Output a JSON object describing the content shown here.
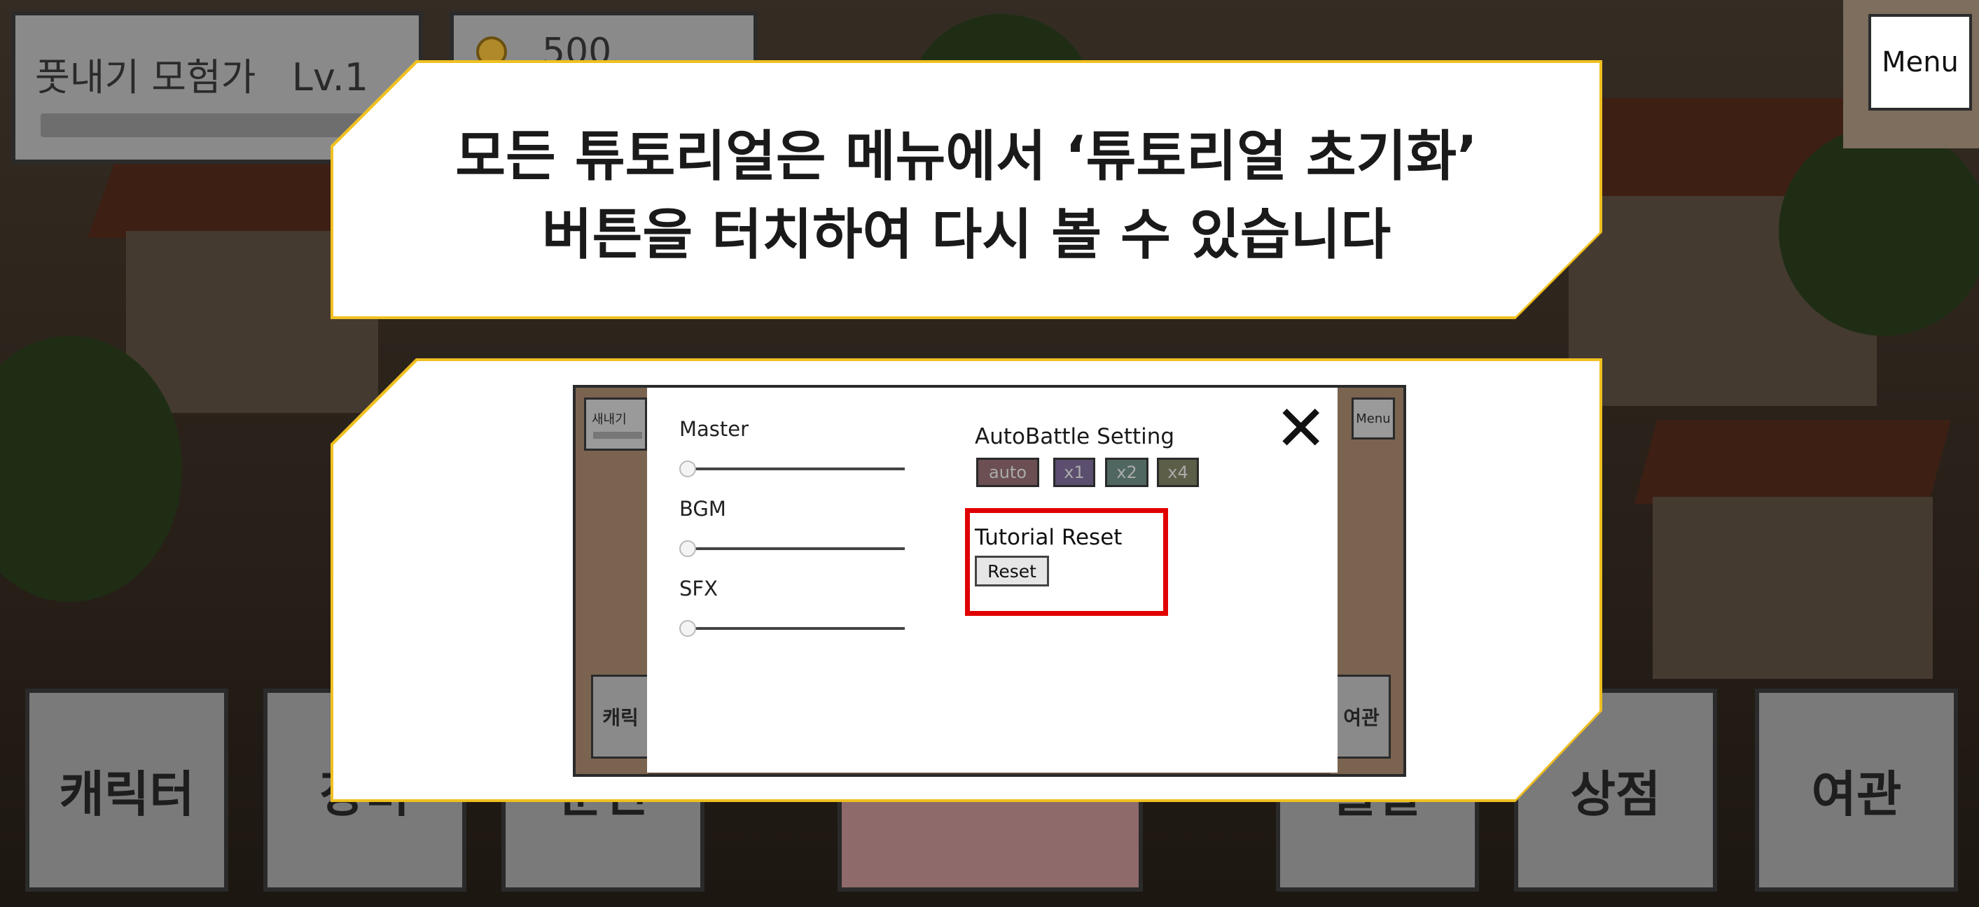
{
  "hud": {
    "player_title": "풋내기 모험가   Lv.1",
    "gold": "500",
    "menu_label": "Menu"
  },
  "bottom_nav": [
    "캐릭터",
    "장비",
    "훈련",
    "",
    "출발",
    "상점",
    "여관"
  ],
  "tutorial": {
    "line1": "모든 튜토리얼은 메뉴에서 ‘튜토리얼 초기화’",
    "line2": "버튼을 터치하여 다시 볼 수 있습니다"
  },
  "example": {
    "mini_name": "새내기",
    "mini_menu": "Menu",
    "mini_character": "캐릭",
    "mini_inn": "여관",
    "close_glyph": "✕",
    "sliders": [
      {
        "label": "Master",
        "value": 0
      },
      {
        "label": "BGM",
        "value": 0
      },
      {
        "label": "SFX",
        "value": 0
      }
    ],
    "auto_battle_title": "AutoBattle Setting",
    "speed_buttons": [
      {
        "label": "auto",
        "color": "#6b4f52"
      },
      {
        "label": "x1",
        "color": "#5b4e6e"
      },
      {
        "label": "x2",
        "color": "#4f6760"
      },
      {
        "label": "x4",
        "color": "#5c5e48"
      }
    ],
    "tutorial_reset_title": "Tutorial Reset",
    "reset_button": "Reset"
  },
  "colors": {
    "highlight_border": "#e00000",
    "panel_border": "#f0c020"
  }
}
